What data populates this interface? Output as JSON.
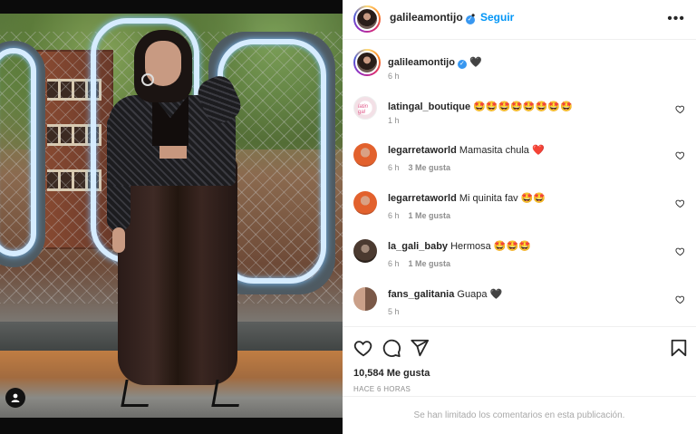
{
  "post": {
    "author": "galileamontijo",
    "follow_label": "Seguir",
    "dot": "•",
    "more_icon": "more-horizontal-icon"
  },
  "caption": {
    "author": "galileamontijo",
    "text": "🖤",
    "time": "6 h"
  },
  "comments": [
    {
      "user": "latingal_boutique",
      "text": "🤩🤩🤩🤩🤩🤩🤩🤩",
      "time": "1 h",
      "likes": ""
    },
    {
      "user": "legarretaworld",
      "text": "Mamasita chula ❤️",
      "time": "6 h",
      "likes": "3 Me gusta"
    },
    {
      "user": "legarretaworld",
      "text": "Mi quinita fav 🤩🤩",
      "time": "6 h",
      "likes": "1 Me gusta"
    },
    {
      "user": "la_gali_baby",
      "text": "Hermosa 🤩🤩🤩",
      "time": "6 h",
      "likes": "1 Me gusta"
    },
    {
      "user": "fans_galitania",
      "text": "Guapa 🖤",
      "time": "5 h",
      "likes": ""
    }
  ],
  "footer": {
    "likes_count": "10,584 Me gusta",
    "time_ago": "Hace 6 horas",
    "comments_limited": "Se han limitado los comentarios en esta publicación."
  },
  "colors": {
    "accent": "#0095f6",
    "verified": "#3897f0",
    "heart_red": "#ed4956"
  }
}
